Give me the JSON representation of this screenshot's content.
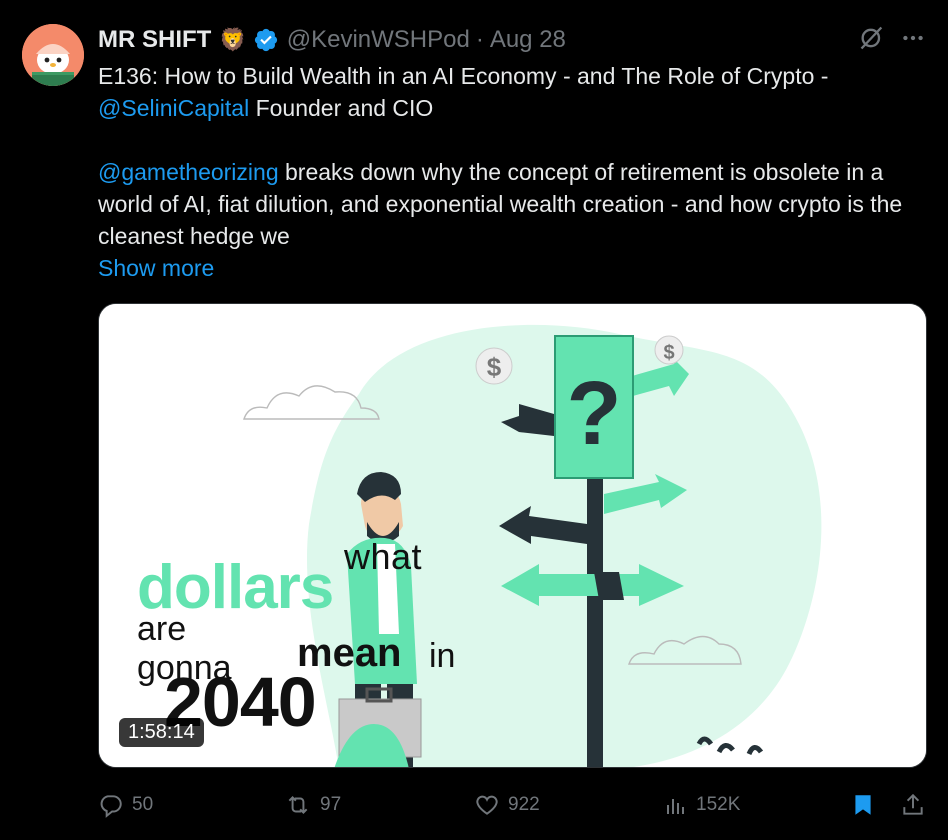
{
  "author": {
    "name": "MR SHIFT",
    "emoji": "🦁",
    "handle": "@KevinWSHPod",
    "separator": "·",
    "date": "Aug 28"
  },
  "tweet": {
    "line1": "E136: How to Build Wealth in an AI Economy - and The Role of Crypto -",
    "mention1": "@SeliniCapital",
    "line2_rest": " Founder and CIO",
    "mention2": "@gametheorizing",
    "body": " breaks down why the concept of retirement is obsolete in a world of AI, fiat dilution, and exponential wealth creation - and how crypto is the cleanest hedge we",
    "show_more": "Show more"
  },
  "media": {
    "duration": "1:58:14",
    "overlay": {
      "what": "what",
      "dollars": "dollars",
      "gonna": "are gonna",
      "mean": "mean",
      "in": "in",
      "year": "2040"
    },
    "sign_symbol": "?",
    "coin_symbol": "$"
  },
  "actions": {
    "replies": "50",
    "reposts": "97",
    "likes": "922",
    "views": "152K"
  },
  "icons": {
    "verified": "verified-badge-icon",
    "grok": "grok-icon",
    "more": "more-options-icon",
    "reply": "reply-icon",
    "repost": "repost-icon",
    "like": "heart-icon",
    "views": "analytics-icon",
    "bookmark": "bookmark-icon",
    "share": "share-icon"
  },
  "colors": {
    "background": "#000000",
    "link": "#1d9bf0",
    "muted": "#71767b",
    "accent_green": "#63e3b0",
    "bookmark": "#1d9bf0"
  }
}
